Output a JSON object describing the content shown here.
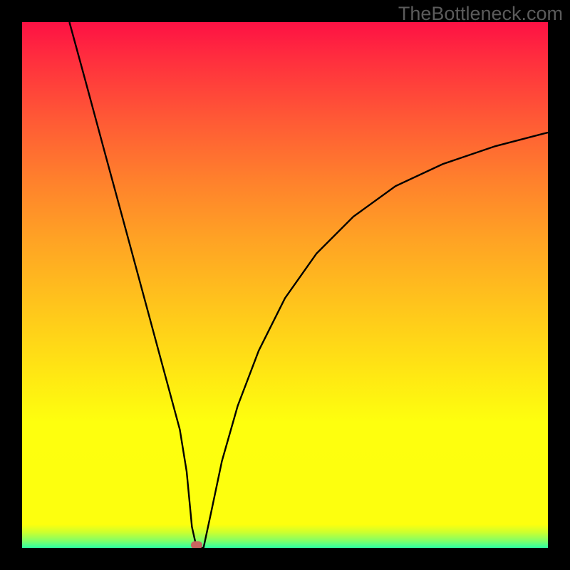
{
  "watermark": "TheBottleneck.com",
  "colors": {
    "frame_bg": "#000000",
    "curve_stroke": "#000000",
    "marker_fill": "#cb6460",
    "gradient_top": "#fe1144",
    "gradient_mid": "#ffc41c",
    "gradient_yellow": "#fdff0e",
    "gradient_bottom": "#2effa1"
  },
  "chart_data": {
    "type": "line",
    "title": "",
    "xlabel": "",
    "ylabel": "",
    "xlim": [
      0,
      100
    ],
    "ylim": [
      0,
      100
    ],
    "grid": false,
    "legend": false,
    "annotations": [
      "TheBottleneck.com"
    ],
    "marker": {
      "x": 33.2,
      "y": 0.5
    },
    "series": [
      {
        "name": "left-branch",
        "x": [
          9.0,
          12.0,
          16.0,
          20.0,
          24.0,
          28.0,
          30.0,
          31.3,
          32.3,
          33.2
        ],
        "values": [
          100.0,
          89.0,
          74.2,
          59.5,
          44.7,
          29.9,
          22.5,
          14.5,
          4.0,
          0.0
        ]
      },
      {
        "name": "floor",
        "x": [
          33.2,
          34.5
        ],
        "values": [
          0.0,
          0.0
        ]
      },
      {
        "name": "right-branch",
        "x": [
          34.5,
          36.0,
          38.0,
          41.0,
          45.0,
          50.0,
          56.0,
          63.0,
          71.0,
          80.0,
          90.0,
          100.0
        ],
        "values": [
          0.0,
          7.0,
          16.5,
          27.0,
          37.5,
          47.5,
          56.0,
          63.0,
          68.8,
          73.0,
          76.4,
          79.0
        ]
      }
    ]
  }
}
